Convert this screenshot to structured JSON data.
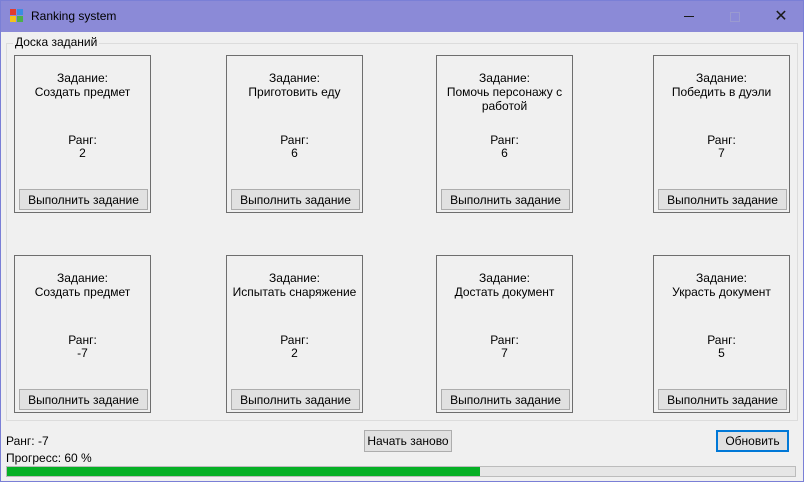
{
  "window": {
    "title": "Ranking system",
    "minimize_icon": "minimize-icon",
    "maximize_icon": "maximize-icon",
    "close_icon": "close-icon",
    "close_glyph": "✕",
    "titlebar_color": "#8b8ad7"
  },
  "board": {
    "title": "Доска заданий",
    "tasks": [
      {
        "task_label": "Задание:",
        "name": "Создать предмет",
        "rank_label": "Ранг:",
        "rank": "2",
        "button": "Выполнить задание"
      },
      {
        "task_label": "Задание:",
        "name": "Приготовить еду",
        "rank_label": "Ранг:",
        "rank": "6",
        "button": "Выполнить задание"
      },
      {
        "task_label": "Задание:",
        "name": "Помочь персонажу с работой",
        "rank_label": "Ранг:",
        "rank": "6",
        "button": "Выполнить задание"
      },
      {
        "task_label": "Задание:",
        "name": "Победить в дуэли",
        "rank_label": "Ранг:",
        "rank": "7",
        "button": "Выполнить задание"
      },
      {
        "task_label": "Задание:",
        "name": "Создать предмет",
        "rank_label": "Ранг:",
        "rank": "-7",
        "button": "Выполнить задание"
      },
      {
        "task_label": "Задание:",
        "name": "Испытать снаряжение",
        "rank_label": "Ранг:",
        "rank": "2",
        "button": "Выполнить задание"
      },
      {
        "task_label": "Задание:",
        "name": "Достать документ",
        "rank_label": "Ранг:",
        "rank": "7",
        "button": "Выполнить задание"
      },
      {
        "task_label": "Задание:",
        "name": "Украсть документ",
        "rank_label": "Ранг:",
        "rank": "5",
        "button": "Выполнить задание"
      }
    ]
  },
  "footer": {
    "rank_text": "Ранг: -7",
    "progress_text": "Прогресс: 60 %",
    "progress_value": 60,
    "progress_color": "#06b025",
    "restart_label": "Начать заново",
    "refresh_label": "Обновить"
  }
}
